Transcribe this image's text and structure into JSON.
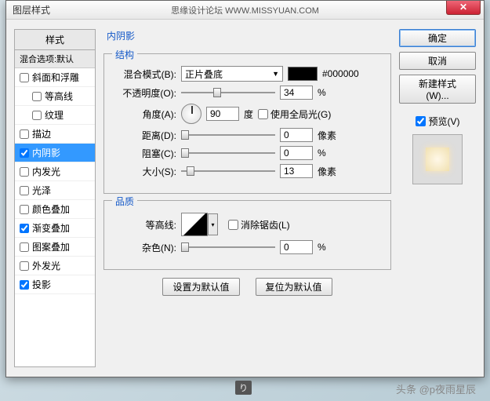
{
  "title": "图层样式",
  "title_center": "思缘设计论坛  WWW.MISSYUAN.COM",
  "sidebar": {
    "header": "样式",
    "sub": "混合选项:默认",
    "items": [
      {
        "label": "斜面和浮雕",
        "checked": false,
        "indent": false
      },
      {
        "label": "等高线",
        "checked": false,
        "indent": true
      },
      {
        "label": "纹理",
        "checked": false,
        "indent": true
      },
      {
        "label": "描边",
        "checked": false,
        "indent": false
      },
      {
        "label": "内阴影",
        "checked": true,
        "indent": false,
        "selected": true
      },
      {
        "label": "内发光",
        "checked": false,
        "indent": false
      },
      {
        "label": "光泽",
        "checked": false,
        "indent": false
      },
      {
        "label": "颜色叠加",
        "checked": false,
        "indent": false
      },
      {
        "label": "渐变叠加",
        "checked": true,
        "indent": false
      },
      {
        "label": "图案叠加",
        "checked": false,
        "indent": false
      },
      {
        "label": "外发光",
        "checked": false,
        "indent": false
      },
      {
        "label": "投影",
        "checked": true,
        "indent": false
      }
    ]
  },
  "panel_title": "内阴影",
  "structure": {
    "legend": "结构",
    "blend_label": "混合模式(B):",
    "blend_value": "正片叠底",
    "color_hex": "#000000",
    "opacity_label": "不透明度(O):",
    "opacity_value": "34",
    "opacity_unit": "%",
    "angle_label": "角度(A):",
    "angle_value": "90",
    "angle_unit": "度",
    "global_light": "使用全局光(G)",
    "distance_label": "距离(D):",
    "distance_value": "0",
    "distance_unit": "像素",
    "choke_label": "阻塞(C):",
    "choke_value": "0",
    "choke_unit": "%",
    "size_label": "大小(S):",
    "size_value": "13",
    "size_unit": "像素"
  },
  "quality": {
    "legend": "品质",
    "contour_label": "等高线:",
    "antialias": "消除锯齿(L)",
    "noise_label": "杂色(N):",
    "noise_value": "0",
    "noise_unit": "%"
  },
  "defaults": {
    "set": "设置为默认值",
    "reset": "复位为默认值"
  },
  "right": {
    "ok": "确定",
    "cancel": "取消",
    "new_style": "新建样式(W)...",
    "preview": "预览(V)"
  },
  "watermark": "头条 @p夜雨星辰"
}
